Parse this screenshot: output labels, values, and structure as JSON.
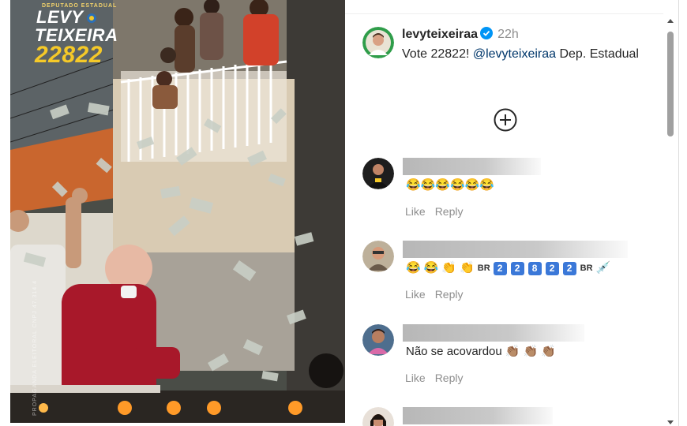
{
  "media": {
    "overlay_small": "DEPUTADO ESTADUAL",
    "overlay_name_first": "LEVY",
    "overlay_name_last": "TEIXEIRA",
    "overlay_number": "22822",
    "overlay_side_text": "PROPAGANDA ELEITORAL CNPJ 47.314.4"
  },
  "post": {
    "username": "levyteixeiraa",
    "verified_icon": "verified-badge-icon",
    "time": "22h",
    "text_before": "Vote 22822! ",
    "mention": "@levyteixeiraa",
    "text_after": " Dep. Estadual",
    "load_more_icon": "plus-circle-icon"
  },
  "comments": [
    {
      "name_hidden": true,
      "text": "😂😂😂😂😂😂",
      "like_label": "Like",
      "reply_label": "Reply"
    },
    {
      "name_hidden": true,
      "sequence_br_1": "BR",
      "keycaps": [
        "2",
        "2",
        "8",
        "2",
        "2"
      ],
      "sequence_br_2": "BR",
      "like_label": "Like",
      "reply_label": "Reply"
    },
    {
      "name_hidden": true,
      "text": "Não se acovardou",
      "like_label": "Like",
      "reply_label": "Reply"
    }
  ],
  "colors": {
    "accent_blue": "#0095f6",
    "mention_blue": "#00376b",
    "secondary_gray": "#8e8e8e",
    "campaign_yellow": "#f5c928"
  }
}
